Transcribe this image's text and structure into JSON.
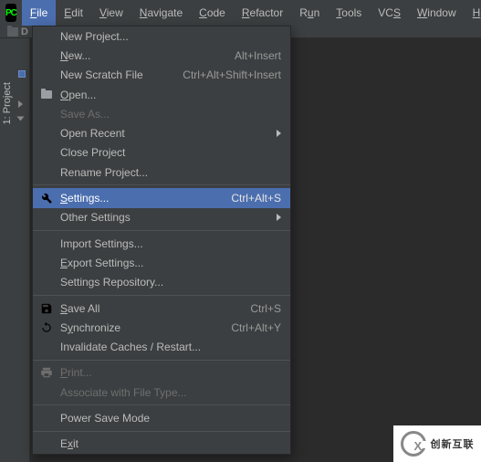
{
  "menubar": {
    "items": [
      {
        "label": "File",
        "ul": "F",
        "open": true
      },
      {
        "label": "Edit",
        "ul": "E"
      },
      {
        "label": "View",
        "ul": "V"
      },
      {
        "label": "Navigate",
        "ul": "N"
      },
      {
        "label": "Code",
        "ul": "C"
      },
      {
        "label": "Refactor",
        "ul": "R"
      },
      {
        "label": "Run",
        "ul": "u",
        "pre": "R"
      },
      {
        "label": "Tools",
        "ul": "T"
      },
      {
        "label": "VCS",
        "ul": "S",
        "pre": "VC"
      },
      {
        "label": "Window",
        "ul": "W"
      },
      {
        "label": "Help",
        "ul": "H"
      }
    ]
  },
  "logo_text": "PC",
  "folder_label": "D",
  "sidebar": {
    "tab": "1: Project",
    "ul": "1"
  },
  "file_menu": [
    {
      "type": "item",
      "label": "New Project..."
    },
    {
      "type": "item",
      "label": "New...",
      "ul": "N",
      "hint": "Alt+Insert"
    },
    {
      "type": "item",
      "label": "New Scratch File",
      "hint": "Ctrl+Alt+Shift+Insert"
    },
    {
      "type": "item",
      "label": "Open...",
      "ul": "O",
      "icon": "folder"
    },
    {
      "type": "item",
      "label": "Save As...",
      "disabled": true
    },
    {
      "type": "item",
      "label": "Open Recent",
      "submenu": true
    },
    {
      "type": "item",
      "label": "Close Project"
    },
    {
      "type": "item",
      "label": "Rename Project..."
    },
    {
      "type": "sep"
    },
    {
      "type": "item",
      "label": "Settings...",
      "ul": "S",
      "hint": "Ctrl+Alt+S",
      "icon": "wrench",
      "selected": true
    },
    {
      "type": "item",
      "label": "Other Settings",
      "submenu": true
    },
    {
      "type": "sep"
    },
    {
      "type": "item",
      "label": "Import Settings..."
    },
    {
      "type": "item",
      "label": "Export Settings...",
      "ul": "E"
    },
    {
      "type": "item",
      "label": "Settings Repository..."
    },
    {
      "type": "sep"
    },
    {
      "type": "item",
      "label": "Save All",
      "ul": "S",
      "hint": "Ctrl+S",
      "icon": "save"
    },
    {
      "type": "item",
      "label": "Synchronize",
      "ul": "y",
      "pre": "S",
      "hint": "Ctrl+Alt+Y",
      "icon": "sync"
    },
    {
      "type": "item",
      "label": "Invalidate Caches / Restart..."
    },
    {
      "type": "sep"
    },
    {
      "type": "item",
      "label": "Print...",
      "ul": "P",
      "icon": "print",
      "disabled": true
    },
    {
      "type": "item",
      "label": "Associate with File Type...",
      "disabled": true
    },
    {
      "type": "sep"
    },
    {
      "type": "item",
      "label": "Power Save Mode"
    },
    {
      "type": "sep"
    },
    {
      "type": "item",
      "label": "Exit",
      "ul": "x",
      "pre": "E"
    }
  ],
  "watermark": "创新互联"
}
